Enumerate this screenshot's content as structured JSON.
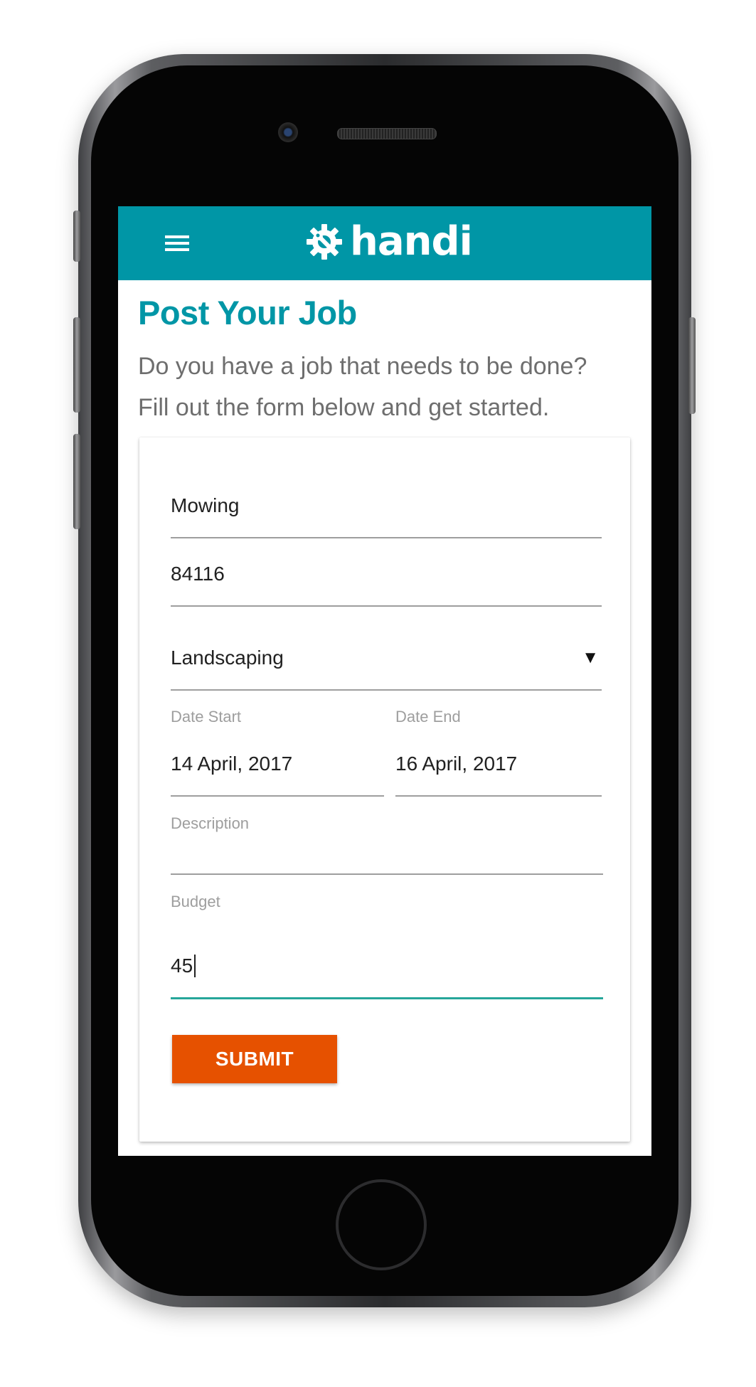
{
  "app": {
    "brand_name": "handi",
    "brand_color": "#0096a6",
    "accent_color": "#e65100",
    "active_field_color": "#26a69a",
    "logo_icon": "gear-wrench-icon",
    "menu_icon": "hamburger-menu-icon"
  },
  "page": {
    "title": "Post Your Job",
    "intro_line1": "Do you have a job that needs to be done?",
    "intro_line2": "Fill out the form below and get started."
  },
  "form": {
    "job_title": {
      "value": "Mowing"
    },
    "zip_code": {
      "value": "84116"
    },
    "category": {
      "selected": "Landscaping",
      "arrow_icon": "dropdown-triangle-icon"
    },
    "date_start": {
      "label": "Date Start",
      "value": "14 April, 2017"
    },
    "date_end": {
      "label": "Date End",
      "value": "16 April, 2017"
    },
    "description": {
      "label": "Description",
      "value": ""
    },
    "budget": {
      "label": "Budget",
      "value": "45",
      "focused": true
    },
    "submit_label": "SUBMIT"
  }
}
